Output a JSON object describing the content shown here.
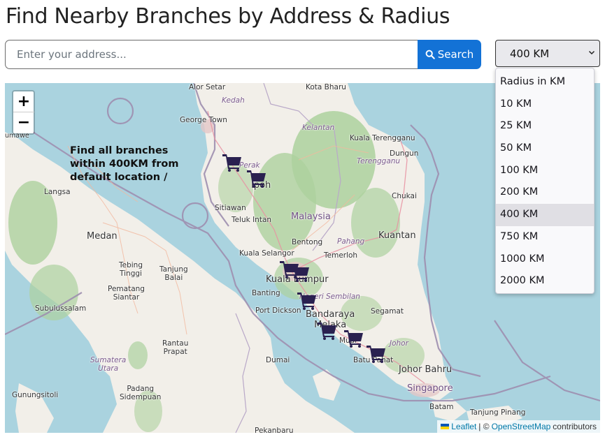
{
  "page": {
    "title": "Find Nearby Branches by Address & Radius"
  },
  "search": {
    "placeholder": "Enter your address...",
    "value": "",
    "button_label": "Search",
    "button_icon": "search-icon"
  },
  "radius": {
    "selected": "400 KM",
    "options": [
      "Radius in KM",
      "10 KM",
      "25 KM",
      "50 KM",
      "100 KM",
      "200 KM",
      "400 KM",
      "750 KM",
      "1000 KM",
      "2000 KM"
    ],
    "highlighted_index": 6
  },
  "map": {
    "zoom_in_label": "+",
    "zoom_out_label": "−",
    "info_text": [
      "Find all branches",
      "within 400KM from",
      "default location /"
    ],
    "marker_icon": "shopping-cart-icon",
    "marker_color": "#2a2150",
    "markers": [
      {
        "near": "Perak (north)"
      },
      {
        "near": "Ipoh"
      },
      {
        "near": "Kuala Lumpur (west)"
      },
      {
        "near": "Kuala Lumpur (east)"
      },
      {
        "near": "Negeri Sembilan"
      },
      {
        "near": "Melaka"
      },
      {
        "near": "Muar"
      },
      {
        "near": "Batu Pahat"
      }
    ],
    "labels": {
      "alor_setar": "Alor Setar",
      "kota_bharu": "Kota Bharu",
      "kedah": "Kedah",
      "george_town": "George Town",
      "kelantan": "Kelantan",
      "kuala_terengganu": "Kuala Terengganu",
      "terengganu": "Terengganu",
      "dungun": "Dungun",
      "chukai": "Chukai",
      "perak": "Perak",
      "ipoh": "Ipoh",
      "lhokseumawe": "umawe",
      "langsa": "Langsa",
      "sitiawan": "Sitiawan",
      "teluk_intan": "Teluk Intan",
      "malaysia": "Malaysia",
      "bentong": "Bentong",
      "pahang": "Pahang",
      "kuantan": "Kuantan",
      "medan": "Medan",
      "kuala_selangor": "Kuala Selangor",
      "temerloh": "Temerloh",
      "tebing_tinggi": "Tebing\nTinggi",
      "tanjung_balai": "Tanjung\nBalai",
      "kuala_lumpur": "Kuala Lumpur",
      "pematang_siantar": "Pematang\nSiantar",
      "banting": "Banting",
      "negeri_sembilan": "Negeri Sembilan",
      "segamat": "Segamat",
      "subulussalam": "Subulussalam",
      "port_dickson": "Port Dickson",
      "bandaraya_melaka": "Bandaraya\nMelaka",
      "muar": "Muar",
      "rantau_prapat": "Rantau\nPrapat",
      "johor": "Johor",
      "sumatera_utara": "Sumatera\nUtara",
      "batu_pahat": "Batu Pahat",
      "dumai": "Dumai",
      "johor_bahru": "Johor Bahru",
      "singapore": "Singapore",
      "gunungsitoli": "Gunungsitoli",
      "padang_sidempuan": "Padang\nSidempuan",
      "batam": "Batam",
      "tanjung_pinang": "Tanjung Pinang",
      "pekanbaru": "Pekanbaru"
    },
    "attribution": {
      "leaflet": "Leaflet",
      "separator": "| ©",
      "osm": "OpenStreetMap",
      "suffix": "contributors"
    }
  }
}
